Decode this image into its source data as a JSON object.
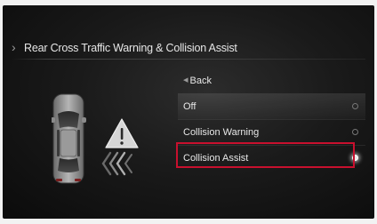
{
  "header": {
    "title": "Rear Cross Traffic Warning & Collision Assist"
  },
  "menu": {
    "back_label": "Back",
    "options": [
      {
        "label": "Off",
        "selected": false
      },
      {
        "label": "Collision Warning",
        "selected": false
      },
      {
        "label": "Collision Assist",
        "selected": true
      }
    ]
  },
  "colors": {
    "highlight": "#c8102e",
    "background": "#151515",
    "text": "#e8e8e8"
  }
}
